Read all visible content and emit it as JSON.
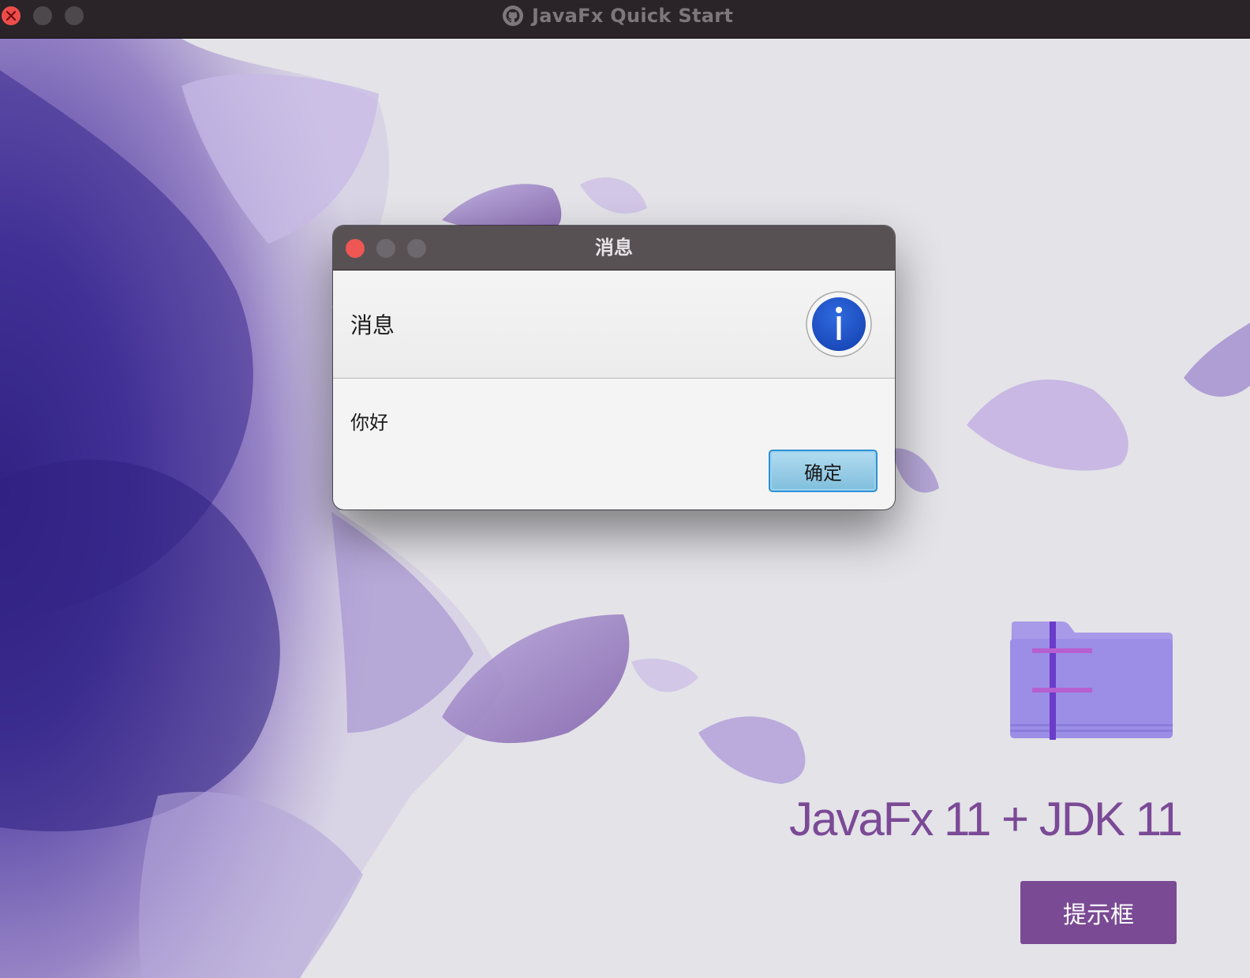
{
  "window": {
    "title": "JavaFx Quick Start",
    "title_icon": "github-icon"
  },
  "colors": {
    "titlebar": "#2a2429",
    "background": "#e4e3e8",
    "accent_purple": "#7a4a94",
    "dialog_button": "#7fbedc",
    "info_blue": "#1f54c4"
  },
  "main": {
    "headline": "JavaFx 11 + JDK 11",
    "button_label": "提示框",
    "folder_icon": "folder-icon"
  },
  "dialog": {
    "title": "消息",
    "header_text": "消息",
    "header_icon": "info-icon",
    "content_text": "你好",
    "ok_label": "确定"
  }
}
